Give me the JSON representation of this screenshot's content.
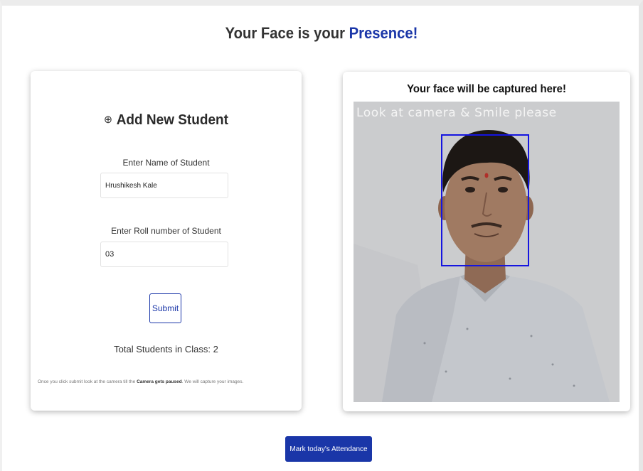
{
  "header": {
    "title_prefix": "Your Face is your ",
    "title_accent": "Presence!"
  },
  "form": {
    "plus_glyph": "⊕",
    "heading": "Add New Student",
    "name_label": "Enter Name of Student",
    "name_value": "Hrushikesh Kale",
    "roll_label": "Enter Roll number of Student",
    "roll_value": "03",
    "submit_label": "Submit",
    "total_students": "Total Students in Class: 2",
    "footnote_before": "Once you click submit look at the camera till the ",
    "footnote_bold": "Camera gets paused",
    "footnote_after": ". We will capture your images."
  },
  "camera": {
    "caption": "Your face will be captured here!",
    "overlay_text": "Look at camera & Smile please"
  },
  "attendance_button": "Mark today's Attendance",
  "colors": {
    "accent": "#1a36a8",
    "face_box": "#1515e0"
  }
}
